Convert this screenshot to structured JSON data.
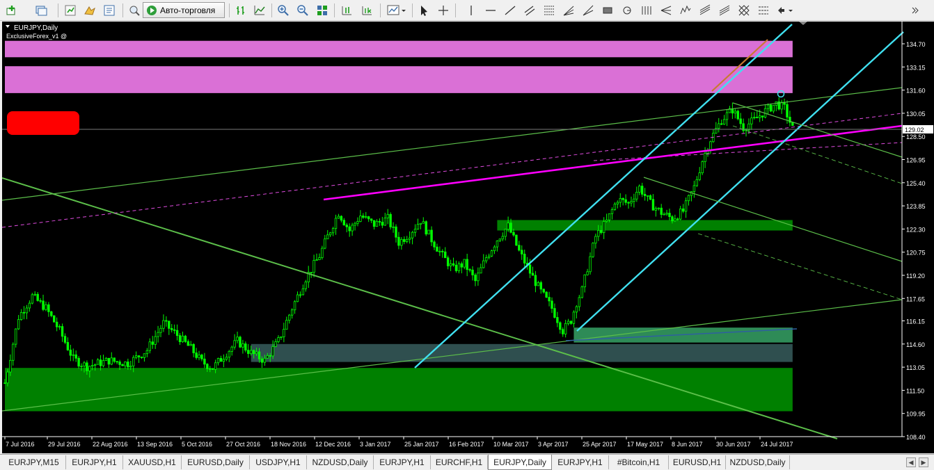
{
  "toolbar": {
    "autotrade_label": "Авто-торговля"
  },
  "chart_title": {
    "symbol": "EURJPY,Daily",
    "indicator": "ExclusiveForex_v1 @"
  },
  "tabs": [
    {
      "label": "EURJPY,M15",
      "active": false
    },
    {
      "label": "EURJPY,H1",
      "active": false
    },
    {
      "label": "XAUUSD,H1",
      "active": false
    },
    {
      "label": "EURUSD,Daily",
      "active": false
    },
    {
      "label": "USDJPY,H1",
      "active": false
    },
    {
      "label": "NZDUSD,Daily",
      "active": false
    },
    {
      "label": "EURJPY,H1",
      "active": false
    },
    {
      "label": "EURCHF,H1",
      "active": false
    },
    {
      "label": "EURJPY,Daily",
      "active": true
    },
    {
      "label": "EURJPY,H1",
      "active": false
    },
    {
      "label": "#Bitcoin,H1",
      "active": false
    },
    {
      "label": "EURUSD,H1",
      "active": false
    },
    {
      "label": "NZDUSD,Daily",
      "active": false
    }
  ],
  "colors": {
    "background": "#000000",
    "bull_candle": "#00ff00",
    "magenta_zone": "#da70d6",
    "green_zone": "#008000",
    "cyan_channel": "#40e0f0",
    "trend_green": "#4caf50",
    "magenta_line": "#ff00ff",
    "red_label": "#ff0000"
  },
  "chart_data": {
    "type": "candlestick",
    "symbol": "EURJPY",
    "timeframe": "Daily",
    "current_price": "129.02",
    "ylim": [
      108.4,
      136.2
    ],
    "y_ticks": [
      "134.70",
      "133.15",
      "131.60",
      "130.05",
      "128.50",
      "126.95",
      "125.40",
      "123.85",
      "122.30",
      "120.75",
      "119.20",
      "117.65",
      "116.15",
      "114.60",
      "113.05",
      "111.50",
      "109.95",
      "108.40"
    ],
    "x_ticks": [
      "7 Jul 2016",
      "29 Jul 2016",
      "22 Aug 2016",
      "13 Sep 2016",
      "5 Oct 2016",
      "27 Oct 2016",
      "18 Nov 2016",
      "12 Dec 2016",
      "3 Jan 2017",
      "25 Jan 2017",
      "16 Feb 2017",
      "10 Mar 2017",
      "3 Apr 2017",
      "25 Apr 2017",
      "17 May 2017",
      "8 Jun 2017",
      "30 Jun 2017",
      "24 Jul 2017"
    ],
    "price_path": [
      [
        0,
        112.0
      ],
      [
        5,
        116.4
      ],
      [
        10,
        117.8
      ],
      [
        15,
        117.0
      ],
      [
        20,
        115.5
      ],
      [
        25,
        113.6
      ],
      [
        30,
        113.1
      ],
      [
        38,
        113.5
      ],
      [
        45,
        113.3
      ],
      [
        52,
        114.2
      ],
      [
        58,
        116.0
      ],
      [
        63,
        115.2
      ],
      [
        68,
        114.3
      ],
      [
        72,
        113.4
      ],
      [
        76,
        113.0
      ],
      [
        80,
        113.8
      ],
      [
        85,
        114.8
      ],
      [
        90,
        114.0
      ],
      [
        95,
        113.5
      ],
      [
        100,
        114.8
      ],
      [
        105,
        117.0
      ],
      [
        110,
        119.0
      ],
      [
        115,
        120.5
      ],
      [
        118,
        121.8
      ],
      [
        122,
        123.4
      ],
      [
        126,
        122.2
      ],
      [
        130,
        123.2
      ],
      [
        135,
        122.6
      ],
      [
        140,
        123.0
      ],
      [
        144,
        121.4
      ],
      [
        148,
        122.0
      ],
      [
        152,
        122.9
      ],
      [
        156,
        121.6
      ],
      [
        160,
        120.5
      ],
      [
        164,
        119.6
      ],
      [
        168,
        120.0
      ],
      [
        172,
        118.8
      ],
      [
        176,
        120.4
      ],
      [
        180,
        121.6
      ],
      [
        184,
        122.5
      ],
      [
        188,
        120.8
      ],
      [
        192,
        119.4
      ],
      [
        196,
        118.1
      ],
      [
        200,
        117.0
      ],
      [
        204,
        115.5
      ],
      [
        207,
        116.2
      ],
      [
        209,
        117.4
      ],
      [
        211,
        118.2
      ],
      [
        213,
        119.7
      ],
      [
        216,
        121.8
      ],
      [
        220,
        122.8
      ],
      [
        224,
        124.3
      ],
      [
        228,
        124.0
      ],
      [
        232,
        125.1
      ],
      [
        236,
        124.0
      ],
      [
        240,
        123.4
      ],
      [
        244,
        123.0
      ],
      [
        248,
        123.5
      ],
      [
        252,
        125.1
      ],
      [
        255,
        126.9
      ],
      [
        258,
        128.3
      ],
      [
        262,
        129.6
      ],
      [
        266,
        130.3
      ],
      [
        270,
        129.1
      ],
      [
        274,
        129.6
      ],
      [
        278,
        130.2
      ],
      [
        282,
        130.7
      ],
      [
        285,
        130.4
      ],
      [
        288,
        129.02
      ]
    ],
    "zones": [
      {
        "type": "resistance",
        "color": "#da70d6",
        "from": 134.9,
        "to": 133.8,
        "start": 0,
        "end": 288
      },
      {
        "type": "resistance",
        "color": "#da70d6",
        "from": 133.2,
        "to": 131.4,
        "start": 0,
        "end": 288
      },
      {
        "type": "support",
        "color": "#008000",
        "from": 122.9,
        "to": 122.2,
        "start": 180,
        "end": 288
      },
      {
        "type": "support",
        "color": "#2e8b57",
        "from": 115.7,
        "to": 114.7,
        "start": 208,
        "end": 288
      },
      {
        "type": "support",
        "color": "#2f4f4f",
        "from": 114.6,
        "to": 113.4,
        "start": 90,
        "end": 288
      },
      {
        "type": "support",
        "color": "#008000",
        "from": 113.0,
        "to": 110.1,
        "start": 0,
        "end": 288
      }
    ]
  }
}
